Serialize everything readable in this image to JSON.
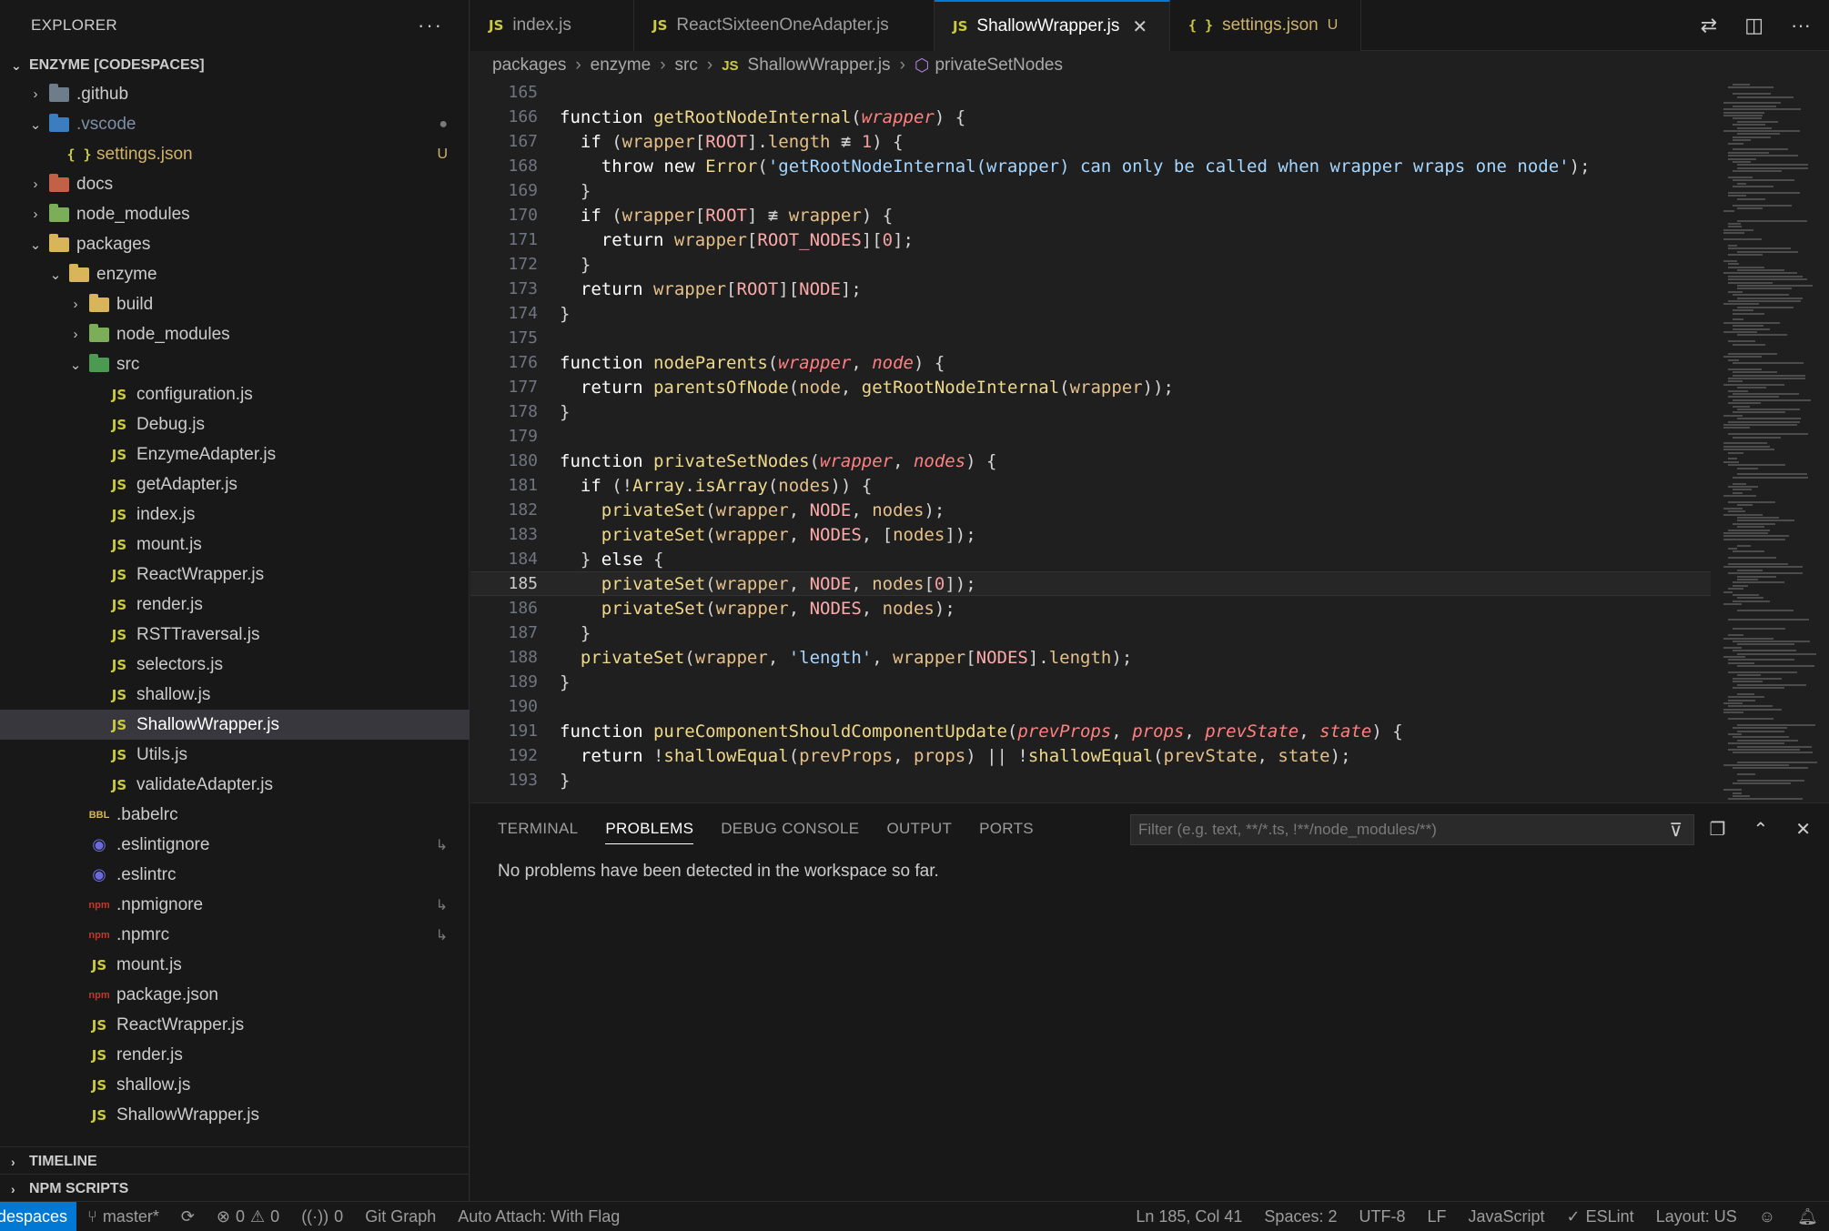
{
  "explorer": {
    "title": "EXPLORER",
    "more": "···",
    "workspace": "ENZYME [CODESPACES]",
    "tree": [
      {
        "label": ".github",
        "indent": 0,
        "type": "folder",
        "open": false,
        "color": "#6d7d8a",
        "icon": "github-folder-icon"
      },
      {
        "label": ".vscode",
        "indent": 0,
        "type": "folder",
        "open": true,
        "color": "#3b7dbf",
        "icon": "vscode-folder-icon",
        "labelColor": "#7f8fa6",
        "badge": "●"
      },
      {
        "label": "settings.json",
        "indent": 1,
        "type": "json",
        "labelColor": "#d0b36b",
        "badge": "U",
        "badgeColor": "#d0b36b"
      },
      {
        "label": "docs",
        "indent": 0,
        "type": "folder",
        "open": false,
        "color": "#c46046",
        "icon": "docs-folder-icon"
      },
      {
        "label": "node_modules",
        "indent": 0,
        "type": "folder",
        "open": false,
        "color": "#7cae5a",
        "icon": "node-folder-icon"
      },
      {
        "label": "packages",
        "indent": 0,
        "type": "folder",
        "open": true,
        "color": "#d9b55a",
        "icon": "packages-folder-icon"
      },
      {
        "label": "enzyme",
        "indent": 1,
        "type": "folder",
        "open": true,
        "color": "#d9b55a",
        "icon": "folder-icon"
      },
      {
        "label": "build",
        "indent": 2,
        "type": "folder",
        "open": false,
        "color": "#d9b55a",
        "icon": "build-folder-icon"
      },
      {
        "label": "node_modules",
        "indent": 2,
        "type": "folder",
        "open": false,
        "color": "#7cae5a",
        "icon": "node-folder-icon"
      },
      {
        "label": "src",
        "indent": 2,
        "type": "folder",
        "open": true,
        "color": "#4c9a52",
        "icon": "src-folder-icon"
      },
      {
        "label": "configuration.js",
        "indent": 3,
        "type": "js"
      },
      {
        "label": "Debug.js",
        "indent": 3,
        "type": "js"
      },
      {
        "label": "EnzymeAdapter.js",
        "indent": 3,
        "type": "js"
      },
      {
        "label": "getAdapter.js",
        "indent": 3,
        "type": "js"
      },
      {
        "label": "index.js",
        "indent": 3,
        "type": "js"
      },
      {
        "label": "mount.js",
        "indent": 3,
        "type": "js"
      },
      {
        "label": "ReactWrapper.js",
        "indent": 3,
        "type": "js"
      },
      {
        "label": "render.js",
        "indent": 3,
        "type": "js"
      },
      {
        "label": "RSTTraversal.js",
        "indent": 3,
        "type": "js"
      },
      {
        "label": "selectors.js",
        "indent": 3,
        "type": "js"
      },
      {
        "label": "shallow.js",
        "indent": 3,
        "type": "js"
      },
      {
        "label": "ShallowWrapper.js",
        "indent": 3,
        "type": "js",
        "active": true
      },
      {
        "label": "Utils.js",
        "indent": 3,
        "type": "js"
      },
      {
        "label": "validateAdapter.js",
        "indent": 3,
        "type": "js"
      },
      {
        "label": ".babelrc",
        "indent": 2,
        "type": "babel"
      },
      {
        "label": ".eslintignore",
        "indent": 2,
        "type": "eslint",
        "badge": "↳"
      },
      {
        "label": ".eslintrc",
        "indent": 2,
        "type": "eslint"
      },
      {
        "label": ".npmignore",
        "indent": 2,
        "type": "npm",
        "badge": "↳"
      },
      {
        "label": ".npmrc",
        "indent": 2,
        "type": "npm",
        "badge": "↳"
      },
      {
        "label": "mount.js",
        "indent": 2,
        "type": "js"
      },
      {
        "label": "package.json",
        "indent": 2,
        "type": "npm"
      },
      {
        "label": "ReactWrapper.js",
        "indent": 2,
        "type": "js"
      },
      {
        "label": "render.js",
        "indent": 2,
        "type": "js"
      },
      {
        "label": "shallow.js",
        "indent": 2,
        "type": "js"
      },
      {
        "label": "ShallowWrapper.js",
        "indent": 2,
        "type": "js"
      }
    ],
    "timeline": "TIMELINE",
    "npm_scripts": "NPM SCRIPTS"
  },
  "tabs": [
    {
      "label": "index.js",
      "icon": "JS",
      "active": false
    },
    {
      "label": "ReactSixteenOneAdapter.js",
      "icon": "JS",
      "active": false
    },
    {
      "label": "ShallowWrapper.js",
      "icon": "JS",
      "active": true,
      "close": "✕"
    },
    {
      "label": "settings.json",
      "icon": "{ }",
      "active": false,
      "modified": "U"
    }
  ],
  "breadcrumb": [
    "packages",
    "enzyme",
    "src",
    "ShallowWrapper.js",
    "privateSetNodes"
  ],
  "code": {
    "current_line": 185,
    "lines": [
      [
        165,
        []
      ],
      [
        166,
        [
          [
            "k",
            "function "
          ],
          [
            "f",
            "getRootNodeInternal"
          ],
          [
            "t",
            "("
          ],
          [
            "p",
            "wrapper"
          ],
          [
            "t",
            ") {"
          ]
        ]
      ],
      [
        167,
        [
          [
            "t",
            "  "
          ],
          [
            "k",
            "if "
          ],
          [
            "t",
            "("
          ],
          [
            "v",
            "wrapper"
          ],
          [
            "t",
            "["
          ],
          [
            "c",
            "ROOT"
          ],
          [
            "t",
            "]."
          ],
          [
            "v",
            "length"
          ],
          [
            "t",
            " ≢ "
          ],
          [
            "n",
            "1"
          ],
          [
            "t",
            ") {"
          ]
        ]
      ],
      [
        168,
        [
          [
            "t",
            "    "
          ],
          [
            "k",
            "throw new "
          ],
          [
            "f",
            "Error"
          ],
          [
            "t",
            "("
          ],
          [
            "s",
            "'getRootNodeInternal(wrapper) can only be called when wrapper wraps one node'"
          ],
          [
            "t",
            ");"
          ]
        ]
      ],
      [
        169,
        [
          [
            "t",
            "  }"
          ]
        ]
      ],
      [
        170,
        [
          [
            "t",
            "  "
          ],
          [
            "k",
            "if "
          ],
          [
            "t",
            "("
          ],
          [
            "v",
            "wrapper"
          ],
          [
            "t",
            "["
          ],
          [
            "c",
            "ROOT"
          ],
          [
            "t",
            "] ≢ "
          ],
          [
            "v",
            "wrapper"
          ],
          [
            "t",
            ") {"
          ]
        ]
      ],
      [
        171,
        [
          [
            "t",
            "    "
          ],
          [
            "k",
            "return "
          ],
          [
            "v",
            "wrapper"
          ],
          [
            "t",
            "["
          ],
          [
            "c",
            "ROOT_NODES"
          ],
          [
            "t",
            "]["
          ],
          [
            "n",
            "0"
          ],
          [
            "t",
            "];"
          ]
        ]
      ],
      [
        172,
        [
          [
            "t",
            "  }"
          ]
        ]
      ],
      [
        173,
        [
          [
            "t",
            "  "
          ],
          [
            "k",
            "return "
          ],
          [
            "v",
            "wrapper"
          ],
          [
            "t",
            "["
          ],
          [
            "c",
            "ROOT"
          ],
          [
            "t",
            "]["
          ],
          [
            "c",
            "NODE"
          ],
          [
            "t",
            "];"
          ]
        ]
      ],
      [
        174,
        [
          [
            "t",
            "}"
          ]
        ]
      ],
      [
        175,
        []
      ],
      [
        176,
        [
          [
            "k",
            "function "
          ],
          [
            "f",
            "nodeParents"
          ],
          [
            "t",
            "("
          ],
          [
            "p",
            "wrapper"
          ],
          [
            "t",
            ", "
          ],
          [
            "p",
            "node"
          ],
          [
            "t",
            ") {"
          ]
        ]
      ],
      [
        177,
        [
          [
            "t",
            "  "
          ],
          [
            "k",
            "return "
          ],
          [
            "f",
            "parentsOfNode"
          ],
          [
            "t",
            "("
          ],
          [
            "v",
            "node"
          ],
          [
            "t",
            ", "
          ],
          [
            "f",
            "getRootNodeInternal"
          ],
          [
            "t",
            "("
          ],
          [
            "v",
            "wrapper"
          ],
          [
            "t",
            "));"
          ]
        ]
      ],
      [
        178,
        [
          [
            "t",
            "}"
          ]
        ]
      ],
      [
        179,
        []
      ],
      [
        180,
        [
          [
            "k",
            "function "
          ],
          [
            "f",
            "privateSetNodes"
          ],
          [
            "t",
            "("
          ],
          [
            "p",
            "wrapper"
          ],
          [
            "t",
            ", "
          ],
          [
            "p",
            "nodes"
          ],
          [
            "t",
            ") {"
          ]
        ]
      ],
      [
        181,
        [
          [
            "t",
            "  "
          ],
          [
            "k",
            "if "
          ],
          [
            "t",
            "(!"
          ],
          [
            "f",
            "Array"
          ],
          [
            "t",
            "."
          ],
          [
            "f",
            "isArray"
          ],
          [
            "t",
            "("
          ],
          [
            "v",
            "nodes"
          ],
          [
            "t",
            ")) {"
          ]
        ]
      ],
      [
        182,
        [
          [
            "t",
            "    "
          ],
          [
            "f",
            "privateSet"
          ],
          [
            "t",
            "("
          ],
          [
            "v",
            "wrapper"
          ],
          [
            "t",
            ", "
          ],
          [
            "c",
            "NODE"
          ],
          [
            "t",
            ", "
          ],
          [
            "v",
            "nodes"
          ],
          [
            "t",
            ");"
          ]
        ]
      ],
      [
        183,
        [
          [
            "t",
            "    "
          ],
          [
            "f",
            "privateSet"
          ],
          [
            "t",
            "("
          ],
          [
            "v",
            "wrapper"
          ],
          [
            "t",
            ", "
          ],
          [
            "c",
            "NODES"
          ],
          [
            "t",
            ", ["
          ],
          [
            "v",
            "nodes"
          ],
          [
            "t",
            "]);"
          ]
        ]
      ],
      [
        184,
        [
          [
            "t",
            "  } "
          ],
          [
            "k",
            "else "
          ],
          [
            "t",
            "{"
          ]
        ]
      ],
      [
        185,
        [
          [
            "t",
            "    "
          ],
          [
            "f",
            "privateSet"
          ],
          [
            "t",
            "("
          ],
          [
            "v",
            "wrapper"
          ],
          [
            "t",
            ", "
          ],
          [
            "c",
            "NODE"
          ],
          [
            "t",
            ", "
          ],
          [
            "v",
            "nodes"
          ],
          [
            "t",
            "["
          ],
          [
            "n",
            "0"
          ],
          [
            "t",
            "]);"
          ]
        ]
      ],
      [
        186,
        [
          [
            "t",
            "    "
          ],
          [
            "f",
            "privateSet"
          ],
          [
            "t",
            "("
          ],
          [
            "v",
            "wrapper"
          ],
          [
            "t",
            ", "
          ],
          [
            "c",
            "NODES"
          ],
          [
            "t",
            ", "
          ],
          [
            "v",
            "nodes"
          ],
          [
            "t",
            ");"
          ]
        ]
      ],
      [
        187,
        [
          [
            "t",
            "  }"
          ]
        ]
      ],
      [
        188,
        [
          [
            "t",
            "  "
          ],
          [
            "f",
            "privateSet"
          ],
          [
            "t",
            "("
          ],
          [
            "v",
            "wrapper"
          ],
          [
            "t",
            ", "
          ],
          [
            "s",
            "'length'"
          ],
          [
            "t",
            ", "
          ],
          [
            "v",
            "wrapper"
          ],
          [
            "t",
            "["
          ],
          [
            "c",
            "NODES"
          ],
          [
            "t",
            "]."
          ],
          [
            "v",
            "length"
          ],
          [
            "t",
            ");"
          ]
        ]
      ],
      [
        189,
        [
          [
            "t",
            "}"
          ]
        ]
      ],
      [
        190,
        []
      ],
      [
        191,
        [
          [
            "k",
            "function "
          ],
          [
            "f",
            "pureComponentShouldComponentUpdate"
          ],
          [
            "t",
            "("
          ],
          [
            "p",
            "prevProps"
          ],
          [
            "t",
            ", "
          ],
          [
            "p",
            "props"
          ],
          [
            "t",
            ", "
          ],
          [
            "p",
            "prevState"
          ],
          [
            "t",
            ", "
          ],
          [
            "p",
            "state"
          ],
          [
            "t",
            ") {"
          ]
        ]
      ],
      [
        192,
        [
          [
            "t",
            "  "
          ],
          [
            "k",
            "return "
          ],
          [
            "t",
            "!"
          ],
          [
            "f",
            "shallowEqual"
          ],
          [
            "t",
            "("
          ],
          [
            "v",
            "prevProps"
          ],
          [
            "t",
            ", "
          ],
          [
            "v",
            "props"
          ],
          [
            "t",
            ") || !"
          ],
          [
            "f",
            "shallowEqual"
          ],
          [
            "t",
            "("
          ],
          [
            "v",
            "prevState"
          ],
          [
            "t",
            ", "
          ],
          [
            "v",
            "state"
          ],
          [
            "t",
            ");"
          ]
        ]
      ],
      [
        193,
        [
          [
            "t",
            "}"
          ]
        ]
      ]
    ]
  },
  "panel": {
    "tabs": [
      "TERMINAL",
      "PROBLEMS",
      "DEBUG CONSOLE",
      "OUTPUT",
      "PORTS"
    ],
    "active_tab": "PROBLEMS",
    "filter_placeholder": "Filter (e.g. text, **/*.ts, !**/node_modules/**)",
    "message": "No problems have been detected in the workspace so far."
  },
  "status": {
    "remote": "Codespaces",
    "branch": "master*",
    "errors": "0",
    "warnings": "0",
    "ports": "0",
    "git_graph": "Git Graph",
    "auto_attach": "Auto Attach: With Flag",
    "position": "Ln 185, Col 41",
    "spaces": "Spaces: 2",
    "encoding": "UTF-8",
    "eol": "LF",
    "language": "JavaScript",
    "eslint": "ESLint",
    "layout": "Layout: US"
  }
}
